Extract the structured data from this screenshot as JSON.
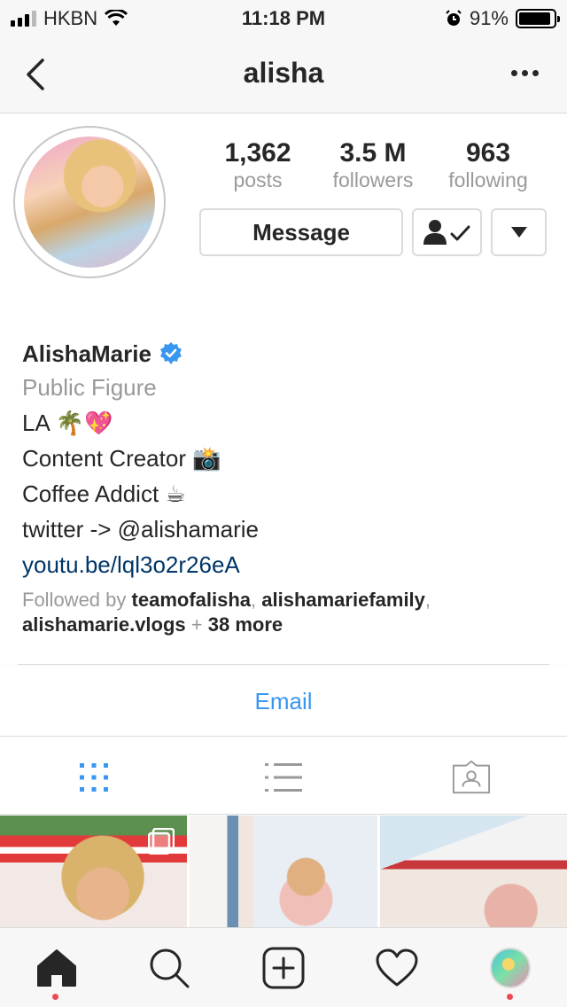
{
  "status_bar": {
    "carrier": "HKBN",
    "time": "11:18 PM",
    "battery": "91%",
    "icons": [
      "signal-icon",
      "wifi-icon",
      "alarm-icon",
      "battery-icon"
    ]
  },
  "nav": {
    "title": "alisha",
    "back_icon": "chevron-left-icon",
    "more_icon": "more-dots-icon"
  },
  "profile": {
    "stats": [
      {
        "value": "1,362",
        "label": "posts"
      },
      {
        "value": "3.5 M",
        "label": "followers"
      },
      {
        "value": "963",
        "label": "following"
      }
    ],
    "message_label": "Message",
    "follow_icon": "following-person-check-icon",
    "dropdown_icon": "triangle-down-icon",
    "name": "AlishaMarie",
    "verified_icon": "verified-badge-icon",
    "category": "Public Figure",
    "bio_lines": [
      "LA 🌴💖",
      "Content Creator 📸",
      "Coffee Addict ☕",
      "twitter -> @alishamarie"
    ],
    "link": "youtu.be/lql3o2r26eA",
    "followed_by": {
      "prefix": "Followed by ",
      "names": [
        "teamofalisha",
        "alishamariefamily",
        "alishamarie.vlogs"
      ],
      "sep1": ", ",
      "sep2": ",",
      "plus": " + ",
      "more": "38 more"
    }
  },
  "email_label": "Email",
  "view_tabs": [
    {
      "icon": "grid-icon",
      "active": true
    },
    {
      "icon": "list-icon",
      "active": false
    },
    {
      "icon": "tagged-photos-icon",
      "active": false
    }
  ],
  "colors": {
    "accent": "#3897f0",
    "link": "#003569",
    "secondary_text": "#999999",
    "notification_dot": "#ed4956"
  },
  "tab_bar": {
    "icons": [
      "home-icon",
      "search-icon",
      "new-post-icon",
      "activity-heart-icon",
      "profile-avatar-icon"
    ]
  }
}
